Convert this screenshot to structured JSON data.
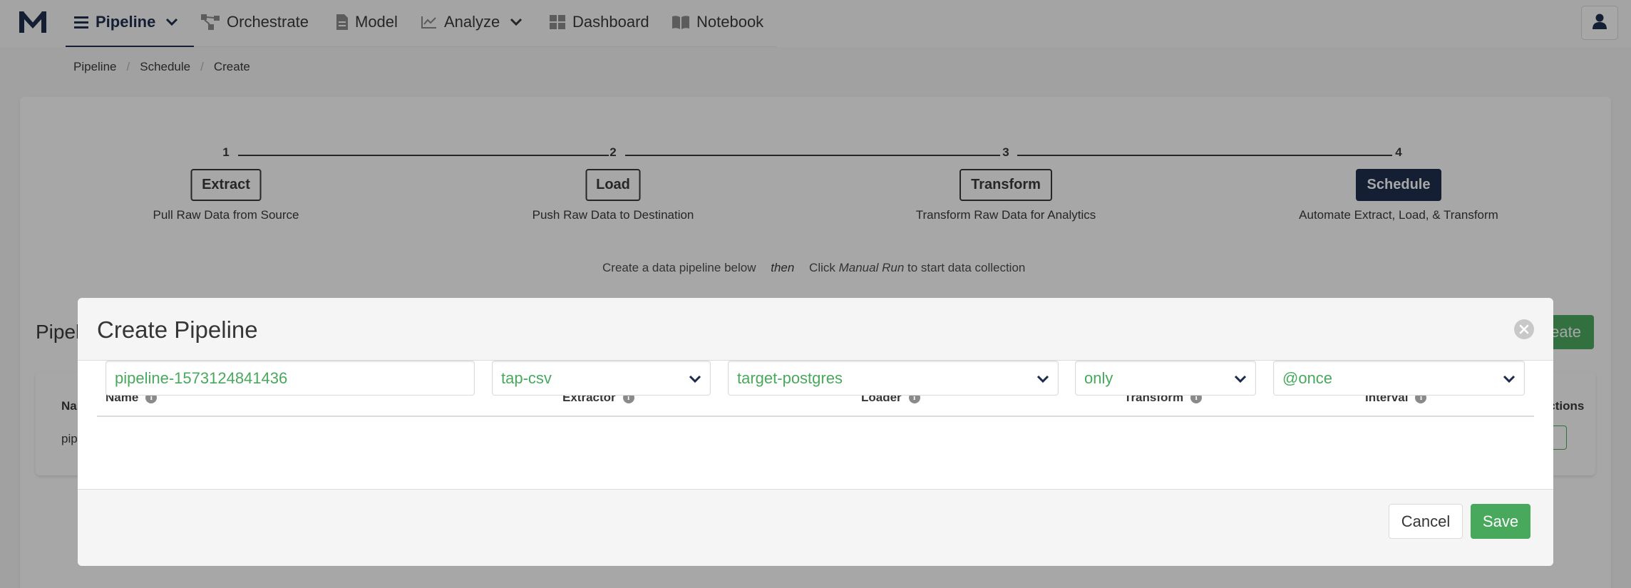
{
  "nav": {
    "items": [
      {
        "label": "Pipeline",
        "icon": "list-icon",
        "has_chevron": true,
        "active": true
      },
      {
        "label": "Orchestrate",
        "icon": "orchestrate-icon"
      },
      {
        "label": "Model",
        "icon": "document-icon"
      },
      {
        "label": "Analyze",
        "icon": "chart-line-icon",
        "has_chevron": true
      },
      {
        "label": "Dashboard",
        "icon": "grid-icon"
      },
      {
        "label": "Notebook",
        "icon": "book-open-icon"
      }
    ],
    "user_icon": "user-icon",
    "logo": "meltano-logo"
  },
  "breadcrumb": [
    "Pipeline",
    "Schedule",
    "Create"
  ],
  "steps": [
    {
      "number": "1",
      "label": "Extract",
      "description": "Pull Raw Data from Source"
    },
    {
      "number": "2",
      "label": "Load",
      "description": "Push Raw Data to Destination"
    },
    {
      "number": "3",
      "label": "Transform",
      "description": "Transform Raw Data for Analytics"
    },
    {
      "number": "4",
      "label": "Schedule",
      "description": "Automate Extract, Load, & Transform",
      "active": true
    }
  ],
  "hint": {
    "part1": "Create a data pipeline below",
    "then": "then",
    "part2_prefix": "Click ",
    "part2_em": "Manual Run",
    "part2_suffix": " to start data collection"
  },
  "background": {
    "section_title": "Pipelines",
    "create_button": "Create",
    "table_header_first": "Name",
    "table_header_last": "Actions",
    "row_first_cell": "pipeline"
  },
  "modal": {
    "title": "Create Pipeline",
    "columns": {
      "name": "Name",
      "extractor": "Extractor",
      "loader": "Loader",
      "transform": "Transform",
      "interval": "Interval"
    },
    "values": {
      "name": "pipeline-1573124841436",
      "extractor": "tap-csv",
      "loader": "target-postgres",
      "transform": "only",
      "interval": "@once"
    },
    "cancel_label": "Cancel",
    "save_label": "Save"
  },
  "colors": {
    "brand_navy": "#1a2b4c",
    "success_green": "#48a95d",
    "overlay": "rgba(10,10,10,0.36)"
  }
}
